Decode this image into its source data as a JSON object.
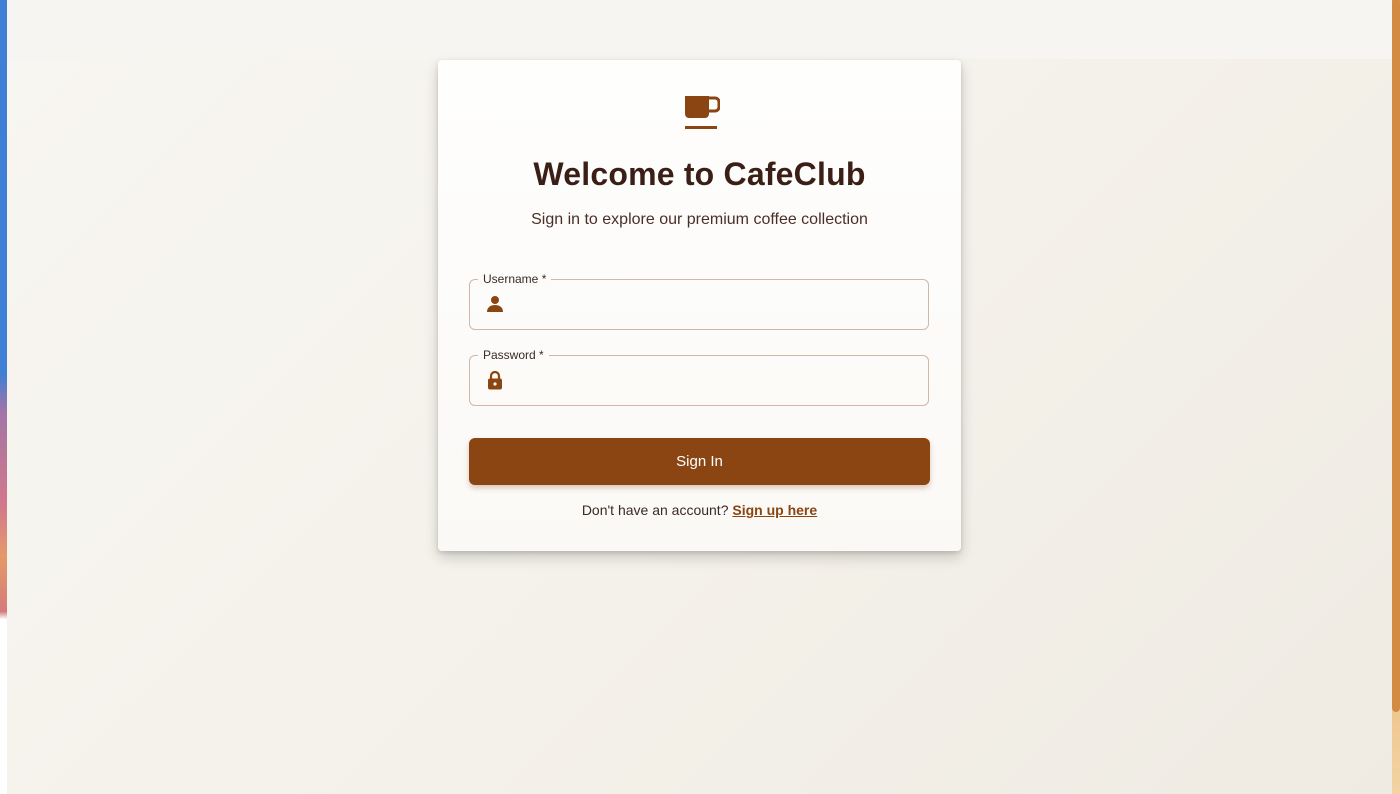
{
  "app": {
    "brand_color": "#8b4513",
    "title_color": "#3b1f17",
    "accent_strip_color": "#d38b44"
  },
  "login": {
    "logo_icon": "coffee-cup-icon",
    "title": "Welcome to CafeClub",
    "subtitle": "Sign in to explore our premium coffee collection",
    "username": {
      "label": "Username *",
      "value": "",
      "icon": "person-icon"
    },
    "password": {
      "label": "Password *",
      "value": "",
      "icon": "lock-icon"
    },
    "submit_label": "Sign In",
    "signup_prompt": "Don't have an account?",
    "signup_link": "Sign up here"
  }
}
